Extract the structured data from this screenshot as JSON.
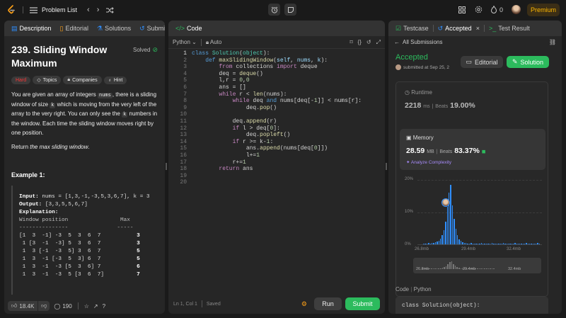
{
  "topbar": {
    "problem_list": "Problem List",
    "premium": "Premium",
    "streak": "0"
  },
  "left": {
    "tabs": [
      "Description",
      "Editorial",
      "Solutions",
      "Submissions"
    ],
    "title": "239. Sliding Window Maximum",
    "solved": "Solved",
    "difficulty": "Hard",
    "pills": [
      "Topics",
      "Companies",
      "Hint"
    ],
    "desc_parts": [
      "You are given an array of integers ",
      "nums",
      ", there is a sliding window of size ",
      "k",
      " which is moving from the very left of the array to the very right. You can only see the ",
      "k",
      " numbers in the window. Each time the sliding window moves right by one position."
    ],
    "return_prefix": "Return ",
    "return_em": "the max sliding window",
    ".": ".",
    "return_suffix": ".",
    "example_title": "Example 1:",
    "input_label": "Input:",
    "input_value": "nums = [1,3,-1,-3,5,3,6,7], k = 3",
    "output_label": "Output:",
    "output_value": "[3,3,5,5,6,7]",
    "explanation_label": "Explanation:",
    "table_header": "Window position                Max",
    "table_rule": "---------------               -----",
    "rows": [
      {
        "w": "[1  3  -1] -3  5  3  6  7 ",
        "m": "3"
      },
      {
        "w": " 1 [3  -1  -3] 5  3  6  7 ",
        "m": "3"
      },
      {
        "w": " 1  3 [-1  -3  5] 3  6  7 ",
        "m": "5"
      },
      {
        "w": " 1  3  -1 [-3  5  3] 6  7 ",
        "m": "5"
      },
      {
        "w": " 1  3  -1  -3 [5  3  6] 7 ",
        "m": "6"
      },
      {
        "w": " 1  3  -1  -3  5 [3  6  7]",
        "m": "7"
      }
    ],
    "likes": "18.4K",
    "comments": "190"
  },
  "code": {
    "tab": "Code",
    "language": "Python",
    "mode": "Auto",
    "status_pos": "Ln 1, Col 1",
    "status_saved": "Saved",
    "run": "Run",
    "submit": "Submit"
  },
  "right": {
    "tabs": [
      "Testcase",
      "Accepted",
      "Test Result"
    ],
    "all_submissions": "All Submissions",
    "accepted": "Accepted",
    "submitted": "submitted at Sep 25, 2",
    "editorial_btn": "Editorial",
    "solution_btn": "Solution",
    "runtime_label": "Runtime",
    "runtime_value": "2218",
    "runtime_unit": "ms",
    "runtime_beats_label": "Beats",
    "runtime_beats": "19.00%",
    "memory_label": "Memory",
    "memory_value": "28.59",
    "memory_unit": "MB",
    "memory_beats_label": "Beats",
    "memory_beats": "83.37%",
    "analyze": "Analyze Complexity",
    "chart_data": {
      "type": "bar",
      "y_ticks": [
        "20%",
        "10%",
        "0%"
      ],
      "x_ticks": [
        "26.8mb",
        "29.4mb",
        "32.4mb"
      ],
      "ylim": [
        0,
        20
      ]
    },
    "code_header": "Code",
    "code_lang": "Python",
    "code_preview": "class Solution(object):"
  }
}
